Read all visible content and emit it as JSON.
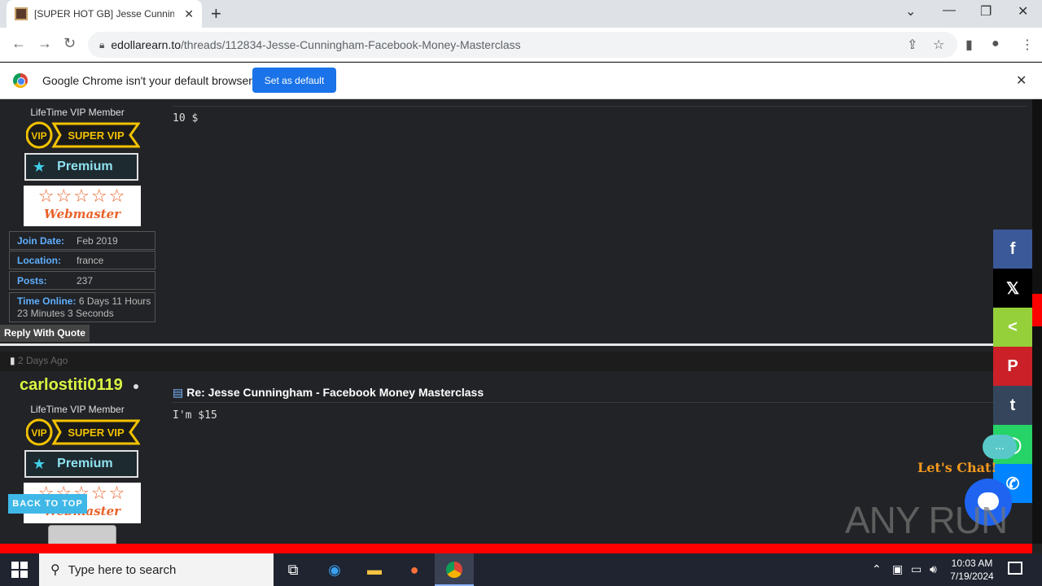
{
  "browser": {
    "tab_title": "[SUPER HOT GB] Jesse Cunningh",
    "url_host": "edollarearn.to",
    "url_path": "/threads/112834-Jesse-Cunningham-Facebook-Money-Masterclass",
    "infobar_text": "Google Chrome isn't your default browser",
    "set_default_label": "Set as default"
  },
  "post1": {
    "rank": "LifeTime VIP Member",
    "vip_label": "SUPER VIP",
    "vip_circle": "VIP",
    "premium_label": "Premium",
    "webmaster_label": "Webmaster",
    "join_date_label": "Join Date:",
    "join_date": "Feb 2019",
    "location_label": "Location:",
    "location": "france",
    "posts_label": "Posts:",
    "posts": "237",
    "time_online_label": "Time Online:",
    "time_online": "6 Days 11 Hours 23 Minutes 3 Seconds",
    "body": "10 $",
    "reply_label": "Reply With Quote"
  },
  "post2": {
    "date": "2 Days Ago",
    "username": "carlostiti0119",
    "rank": "LifeTime VIP Member",
    "vip_label": "SUPER VIP",
    "vip_circle": "VIP",
    "premium_label": "Premium",
    "webmaster_label": "Webmaster",
    "title": "Re: Jesse Cunningham - Facebook Money Masterclass",
    "body": "I'm $15"
  },
  "back_to_top": "BACK TO TOP",
  "share": {
    "items": [
      {
        "name": "facebook",
        "glyph": "f",
        "color": "#3b5998"
      },
      {
        "name": "x",
        "glyph": "𝕏",
        "color": "#000000"
      },
      {
        "name": "share",
        "glyph": "<",
        "color": "#95d03a"
      },
      {
        "name": "pinterest",
        "glyph": "P",
        "color": "#cb2027"
      },
      {
        "name": "tumblr",
        "glyph": "t",
        "color": "#35465c"
      },
      {
        "name": "whatsapp",
        "glyph": "◯",
        "color": "#25d366"
      },
      {
        "name": "messenger",
        "glyph": "✆",
        "color": "#0084ff"
      }
    ]
  },
  "chat": {
    "bubble": "...",
    "lets_chat": "Let's Chat!"
  },
  "watermark": "ANY RUN",
  "taskbar": {
    "search_placeholder": "Type here to search",
    "time": "10:03 AM",
    "date": "7/19/2024"
  }
}
